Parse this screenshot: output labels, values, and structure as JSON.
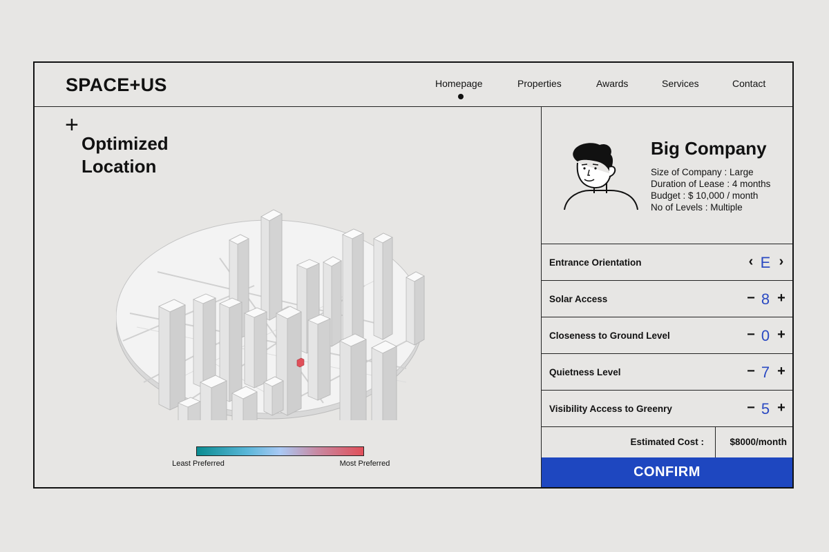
{
  "header": {
    "logo": "SPACE+US",
    "nav": [
      {
        "label": "Homepage",
        "active": true
      },
      {
        "label": "Properties",
        "active": false
      },
      {
        "label": "Awards",
        "active": false
      },
      {
        "label": "Services",
        "active": false
      },
      {
        "label": "Contact",
        "active": false
      }
    ]
  },
  "main": {
    "plus_mark": "+",
    "title": "Optimized Location",
    "legend": {
      "least": "Least Preferred",
      "most": "Most Preferred",
      "colors": [
        "#0b8c91",
        "#a9c9f4",
        "#e0505a"
      ]
    },
    "highlight_color": "#e0505a"
  },
  "profile": {
    "company_name": "Big Company",
    "details": [
      "Size of Company : Large",
      "Duration of Lease : 4 months",
      "Budget : $ 10,000 / month",
      "No of Levels : Multiple"
    ]
  },
  "controls": [
    {
      "label": "Entrance Orientation",
      "value": "E",
      "left": "‹",
      "right": "›",
      "left_icon": "chevron-left-icon",
      "right_icon": "chevron-right-icon"
    },
    {
      "label": "Solar Access",
      "value": "8",
      "left": "−",
      "right": "+",
      "left_icon": "minus-icon",
      "right_icon": "plus-icon"
    },
    {
      "label": "Closeness to Ground Level",
      "value": "0",
      "left": "−",
      "right": "+",
      "left_icon": "minus-icon",
      "right_icon": "plus-icon"
    },
    {
      "label": "Quietness Level",
      "value": "7",
      "left": "−",
      "right": "+",
      "left_icon": "minus-icon",
      "right_icon": "plus-icon"
    },
    {
      "label": "Visibility Access to Greenry",
      "value": "5",
      "left": "−",
      "right": "+",
      "left_icon": "minus-icon",
      "right_icon": "plus-icon"
    }
  ],
  "cost": {
    "label": "Estimated Cost :",
    "value": "$8000/month"
  },
  "confirm_label": "CONFIRM",
  "accent_color": "#1e47c0",
  "value_color": "#2a49c2"
}
